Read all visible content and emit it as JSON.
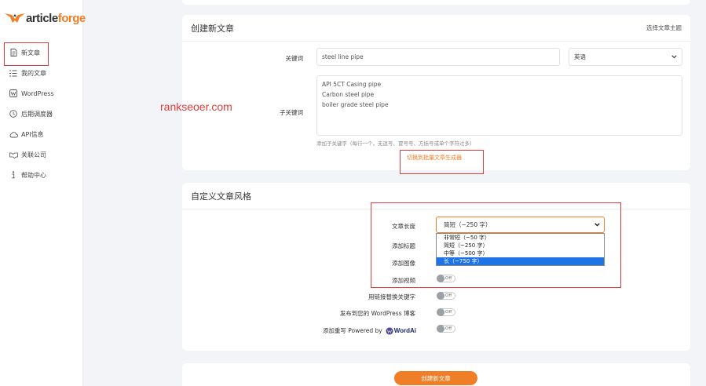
{
  "brand": {
    "name_part1": "article",
    "name_part2": "forge",
    "accent": "#f07e26"
  },
  "sidebar": {
    "items": [
      {
        "label": "新文章",
        "icon": "document-icon"
      },
      {
        "label": "我的文章",
        "icon": "list-icon"
      },
      {
        "label": "WordPress",
        "icon": "wordpress-icon"
      },
      {
        "label": "后期调度器",
        "icon": "clock-icon"
      },
      {
        "label": "API信息",
        "icon": "cloud-icon"
      },
      {
        "label": "关联公司",
        "icon": "handshake-icon"
      },
      {
        "label": "帮助中心",
        "icon": "info-icon"
      }
    ]
  },
  "watermark": "rankseoer.com",
  "create_article": {
    "title": "创建新文章",
    "topic_link": "选择文章主题",
    "keyword_label": "关键词",
    "keyword_value": "steel line pipe",
    "language_value": "英语",
    "sub_keyword_label": "子关键词",
    "sub_keywords": [
      "API 5CT Casing pipe",
      "Carbon steel pipe",
      "boiler grade steel pipe"
    ],
    "sub_keyword_hint": "添加子关键字（每行一个，无逗号、冒号号、方括号或单个字符过多）",
    "bulk_switch_link": "切换到批量文章生成器"
  },
  "custom_style": {
    "title": "自定义文章风格",
    "length_label": "文章长度",
    "length_selected": "简短（~250 字）",
    "length_options": [
      {
        "label": "非常短（~50 字）",
        "selected": false
      },
      {
        "label": "简短（~250 字）",
        "selected": false
      },
      {
        "label": "中等（~500 字）",
        "selected": false
      },
      {
        "label": "长（~750 字）",
        "selected": true
      }
    ],
    "add_title_label": "添加标题",
    "add_image_label": "添加图像",
    "add_video_label": "添加视频",
    "link_replace_label": "用链接替换关键字",
    "publish_wp_label": "发布到您的 WordPress 博客",
    "add_rewrite_label": "添加重写 Powered by",
    "wordai_name": "WordAi",
    "toggle_off_text": "Off"
  },
  "create_button": "创建新文章"
}
